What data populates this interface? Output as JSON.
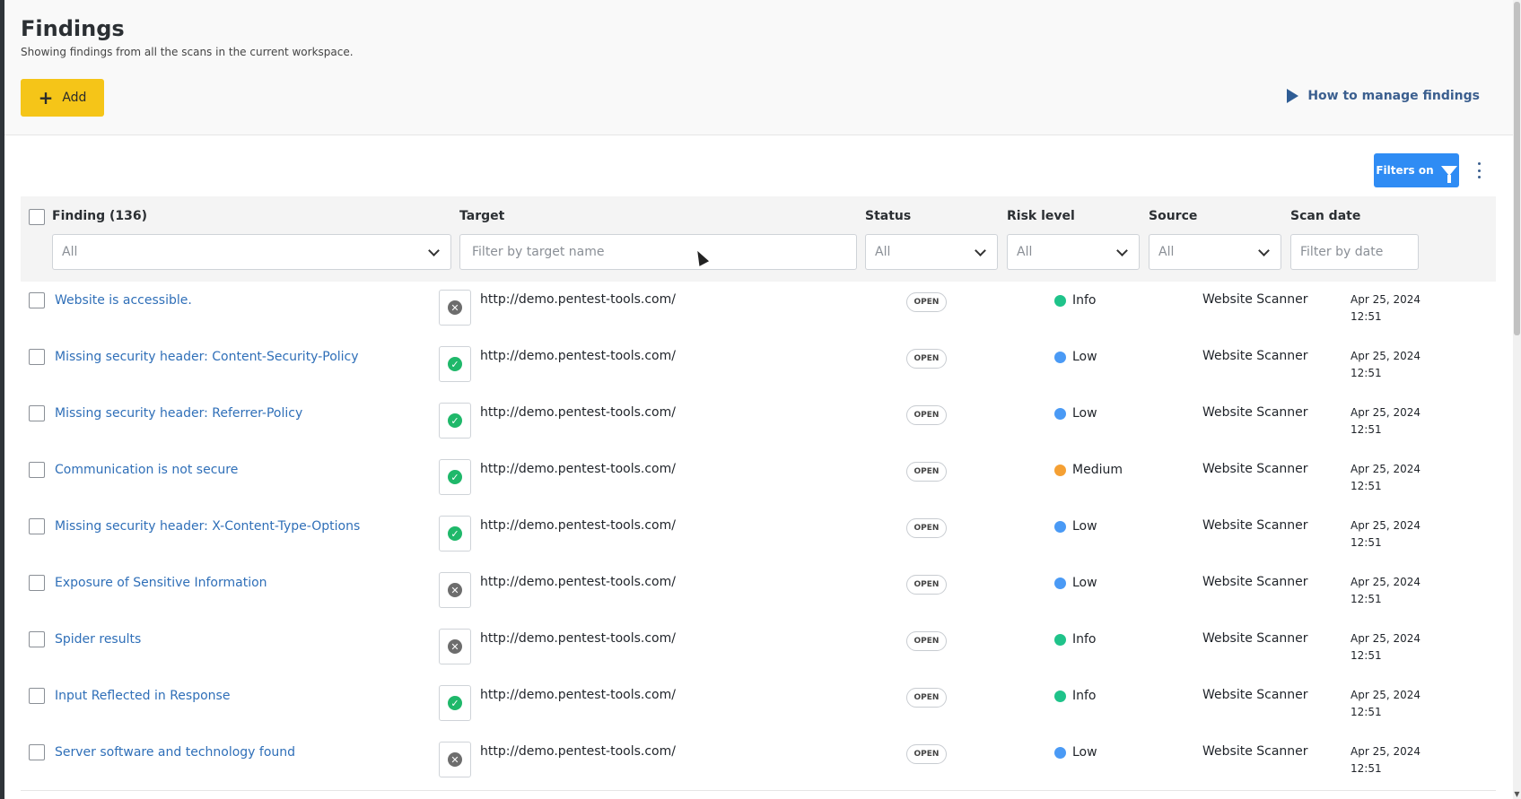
{
  "header": {
    "title": "Findings",
    "subtitle": "Showing findings from all the scans in the current workspace.",
    "add_label": "Add",
    "how_to_label": "How to manage findings"
  },
  "toolbar": {
    "filters_label": "Filters on"
  },
  "columns": {
    "finding": "Finding (136)",
    "target": "Target",
    "status": "Status",
    "risk": "Risk level",
    "source": "Source",
    "scan_date": "Scan date"
  },
  "filters": {
    "finding_value": "All",
    "target_placeholder": "Filter by target name",
    "status_value": "All",
    "risk_value": "All",
    "source_value": "All",
    "date_placeholder": "Filter by date"
  },
  "risk_colors": {
    "Info": "#1fc38a",
    "Low": "#4a9af5",
    "Medium": "#f5a033"
  },
  "rows": [
    {
      "finding": "Website is accessible.",
      "verified": false,
      "target": "http://demo.pentest-tools.com/",
      "status": "OPEN",
      "risk": "Info",
      "source": "Website Scanner",
      "date": "Apr 25, 2024",
      "time": "12:51"
    },
    {
      "finding": "Missing security header: Content-Security-Policy",
      "verified": true,
      "target": "http://demo.pentest-tools.com/",
      "status": "OPEN",
      "risk": "Low",
      "source": "Website Scanner",
      "date": "Apr 25, 2024",
      "time": "12:51"
    },
    {
      "finding": "Missing security header: Referrer-Policy",
      "verified": true,
      "target": "http://demo.pentest-tools.com/",
      "status": "OPEN",
      "risk": "Low",
      "source": "Website Scanner",
      "date": "Apr 25, 2024",
      "time": "12:51"
    },
    {
      "finding": "Communication is not secure",
      "verified": true,
      "target": "http://demo.pentest-tools.com/",
      "status": "OPEN",
      "risk": "Medium",
      "source": "Website Scanner",
      "date": "Apr 25, 2024",
      "time": "12:51"
    },
    {
      "finding": "Missing security header: X-Content-Type-Options",
      "verified": true,
      "target": "http://demo.pentest-tools.com/",
      "status": "OPEN",
      "risk": "Low",
      "source": "Website Scanner",
      "date": "Apr 25, 2024",
      "time": "12:51"
    },
    {
      "finding": "Exposure of Sensitive Information",
      "verified": false,
      "target": "http://demo.pentest-tools.com/",
      "status": "OPEN",
      "risk": "Low",
      "source": "Website Scanner",
      "date": "Apr 25, 2024",
      "time": "12:51"
    },
    {
      "finding": "Spider results",
      "verified": false,
      "target": "http://demo.pentest-tools.com/",
      "status": "OPEN",
      "risk": "Info",
      "source": "Website Scanner",
      "date": "Apr 25, 2024",
      "time": "12:51"
    },
    {
      "finding": "Input Reflected in Response",
      "verified": true,
      "target": "http://demo.pentest-tools.com/",
      "status": "OPEN",
      "risk": "Info",
      "source": "Website Scanner",
      "date": "Apr 25, 2024",
      "time": "12:51"
    },
    {
      "finding": "Server software and technology found",
      "verified": false,
      "target": "http://demo.pentest-tools.com/",
      "status": "OPEN",
      "risk": "Low",
      "source": "Website Scanner",
      "date": "Apr 25, 2024",
      "time": "12:51"
    }
  ]
}
